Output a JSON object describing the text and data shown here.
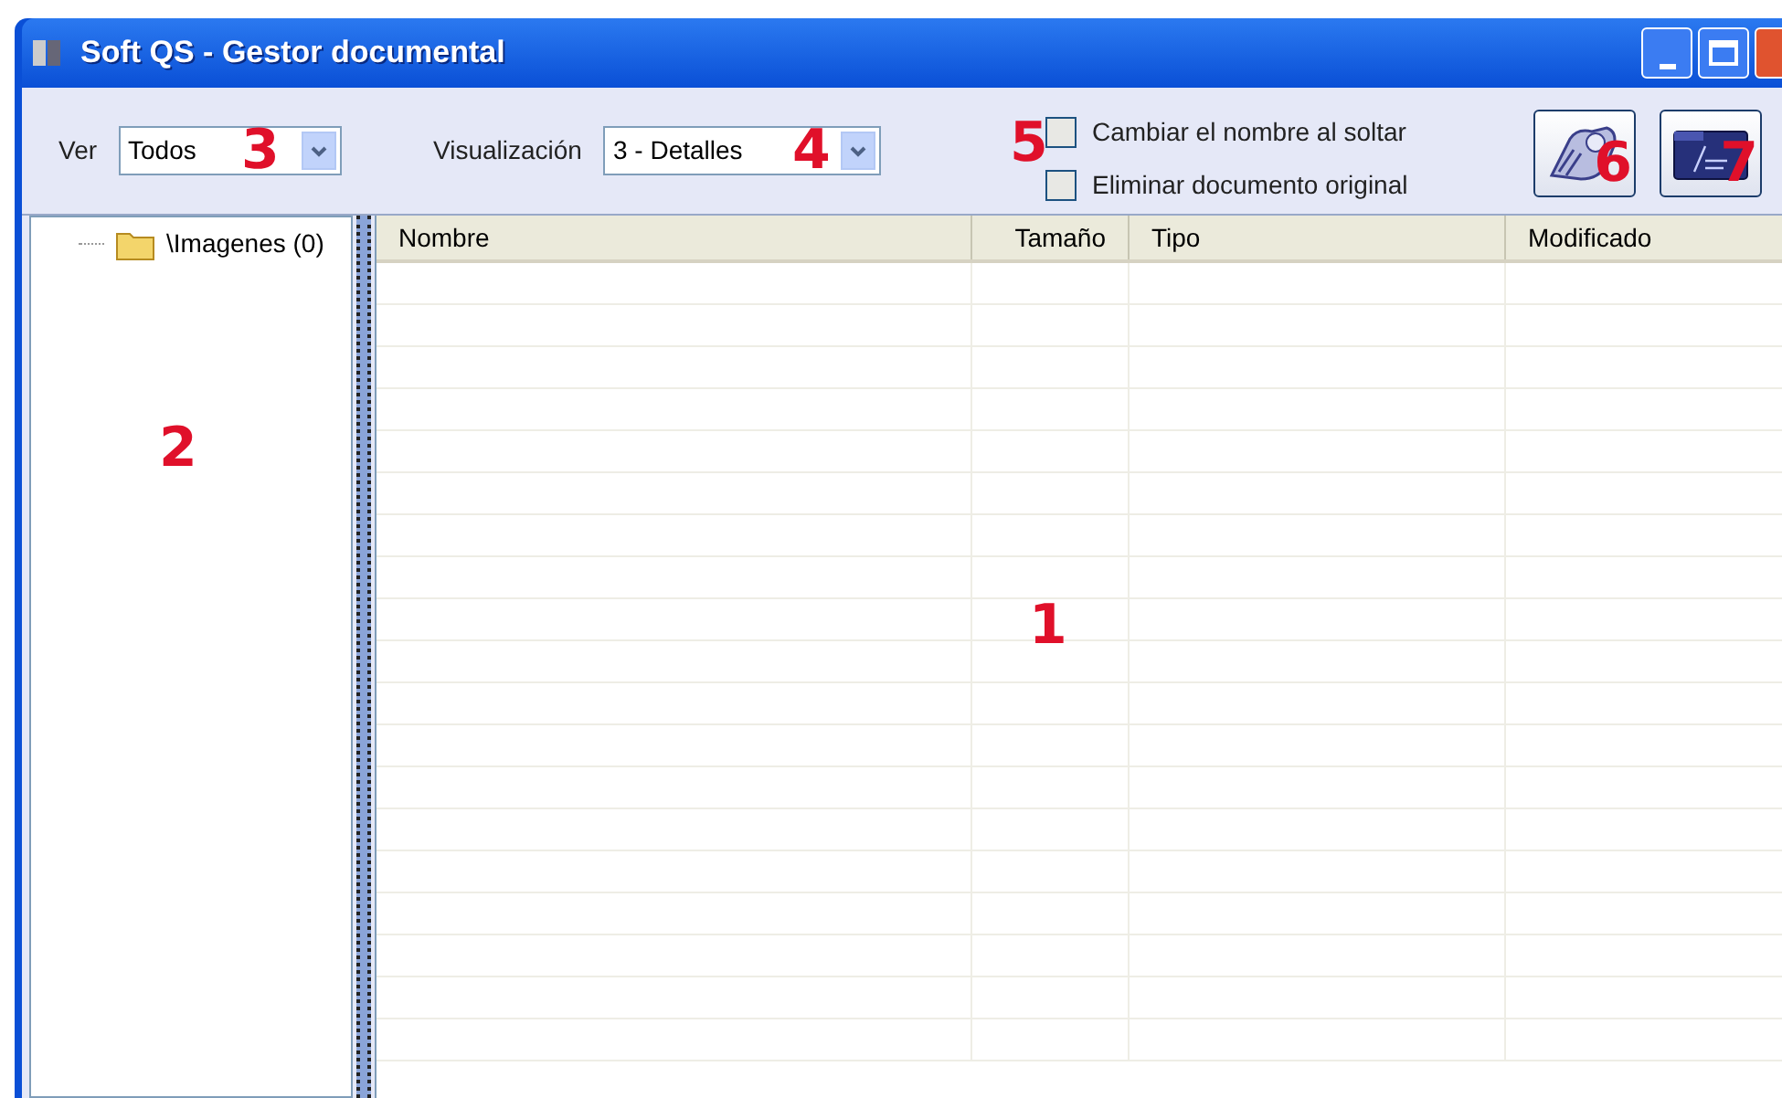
{
  "window": {
    "title": "Soft QS - Gestor documental"
  },
  "toolbar": {
    "ver": {
      "label": "Ver",
      "value": "Todos",
      "callout": "3"
    },
    "visualizacion": {
      "label": "Visualización",
      "value": "3 - Detalles",
      "callout": "4"
    },
    "options_callout": "5",
    "options": [
      {
        "label": "Cambiar el nombre al soltar",
        "checked": false
      },
      {
        "label": "Eliminar documento original",
        "checked": false
      }
    ],
    "buttons": [
      {
        "kind": "scanner",
        "callout": "6"
      },
      {
        "kind": "folder",
        "callout": "7"
      }
    ]
  },
  "tree": {
    "items": [
      {
        "label": "\\Imagenes (0)"
      }
    ],
    "callout": "2"
  },
  "list": {
    "columns": [
      "Nombre",
      "Tamaño",
      "Tipo",
      "Modificado"
    ],
    "callout": "1"
  }
}
